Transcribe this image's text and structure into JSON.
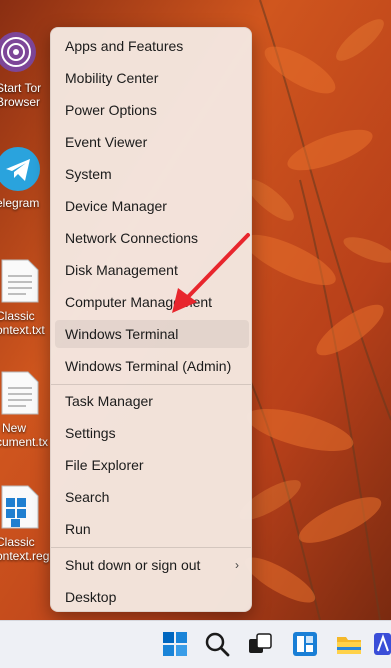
{
  "desktop": {
    "icons": [
      {
        "label_line1": "Start Tor",
        "label_line2": "Browser",
        "icon": "tor-browser-icon"
      },
      {
        "label_line1": "elegram",
        "label_line2": "",
        "icon": "telegram-icon"
      },
      {
        "label_line1": "Classic",
        "label_line2": "ontext.txt",
        "icon": "text-file-icon"
      },
      {
        "label_line1": "New",
        "label_line2": "cument.tx",
        "icon": "text-file-icon"
      },
      {
        "label_line1": "Classic",
        "label_line2": "ontext.reg",
        "icon": "registry-file-icon"
      }
    ]
  },
  "context_menu": {
    "items": [
      {
        "label": "Apps and Features"
      },
      {
        "label": "Mobility Center"
      },
      {
        "label": "Power Options"
      },
      {
        "label": "Event Viewer"
      },
      {
        "label": "System"
      },
      {
        "label": "Device Manager"
      },
      {
        "label": "Network Connections"
      },
      {
        "label": "Disk Management"
      },
      {
        "label": "Computer Management"
      },
      {
        "label": "Windows Terminal"
      },
      {
        "label": "Windows Terminal (Admin)"
      },
      {
        "label": "Task Manager"
      },
      {
        "label": "Settings"
      },
      {
        "label": "File Explorer"
      },
      {
        "label": "Search"
      },
      {
        "label": "Run"
      },
      {
        "label": "Shut down or sign out",
        "submenu_arrow": "›"
      },
      {
        "label": "Desktop"
      }
    ],
    "highlighted": "Windows Terminal"
  },
  "taskbar": {
    "icons": [
      "start-icon",
      "search-icon",
      "task-view-icon",
      "widgets-icon",
      "file-explorer-icon",
      "app-icon"
    ]
  },
  "colors": {
    "menu_bg": "#f4e7e0",
    "arrow": "#e8262d",
    "taskbar_bg": "#eef0f5",
    "start_blue": "#0067c0"
  }
}
